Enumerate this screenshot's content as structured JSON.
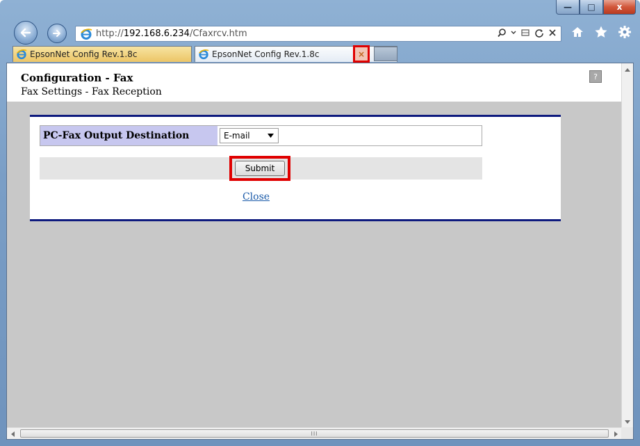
{
  "browser": {
    "address": {
      "scheme": "http://",
      "host": "192.168.6.234",
      "path": "/Cfaxrcv.htm"
    },
    "window_controls": {
      "minimize": "—",
      "maximize": "□",
      "close": "x"
    },
    "tabs": [
      {
        "label": "EpsonNet Config Rev.1.8c",
        "active": false
      },
      {
        "label": "EpsonNet Config Rev.1.8c",
        "active": true
      }
    ],
    "tab_close_glyph": "×",
    "highlight_color": "#e00000"
  },
  "page": {
    "title": "Configuration - Fax",
    "subtitle": "Fax Settings - Fax Reception",
    "help_glyph": "?",
    "setting": {
      "label": "PC-Fax Output Destination",
      "value": "E-mail"
    },
    "submit_label": "Submit",
    "close_label": "Close",
    "accent_color": "#0d1a7e"
  },
  "scrollbar": {
    "thumb_grip": "III"
  }
}
